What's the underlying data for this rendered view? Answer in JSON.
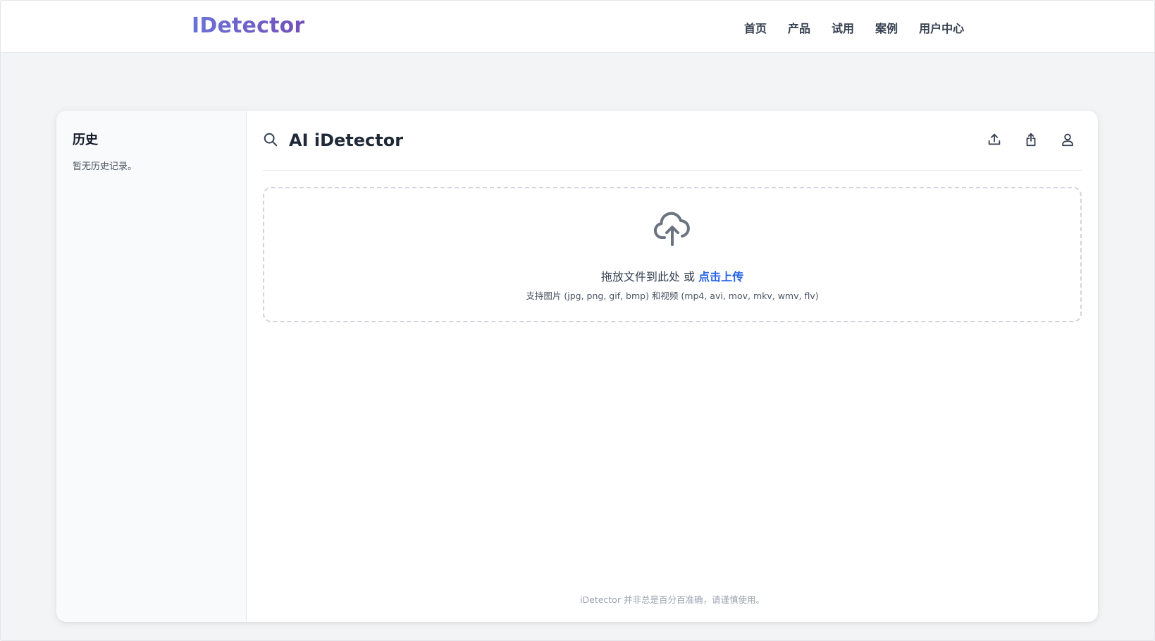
{
  "nav": {
    "brand": "IDetector",
    "links": [
      "首页",
      "产品",
      "试用",
      "案例",
      "用户中心"
    ]
  },
  "sidebar": {
    "title": "历史",
    "empty_text": "暂无历史记录。"
  },
  "main": {
    "title": "AI iDetector",
    "header_icons": [
      "search-icon",
      "upload-icon",
      "share-icon",
      "user-icon"
    ]
  },
  "dropzone": {
    "icon": "cloud-upload-icon",
    "prompt": "拖放文件到此处 或",
    "link": "点击上传",
    "support": "支持图片 (jpg, png, gif, bmp) 和视频 (mp4, avi, mov, mkv, wmv, flv)"
  },
  "footer": {
    "note": "iDetector 并非总是百分百准确，请谨慎使用。"
  },
  "colors": {
    "brand_start": "#6b73d6",
    "brand_end": "#7350b8",
    "link": "#2563eb",
    "page_bg": "#f3f4f6"
  }
}
